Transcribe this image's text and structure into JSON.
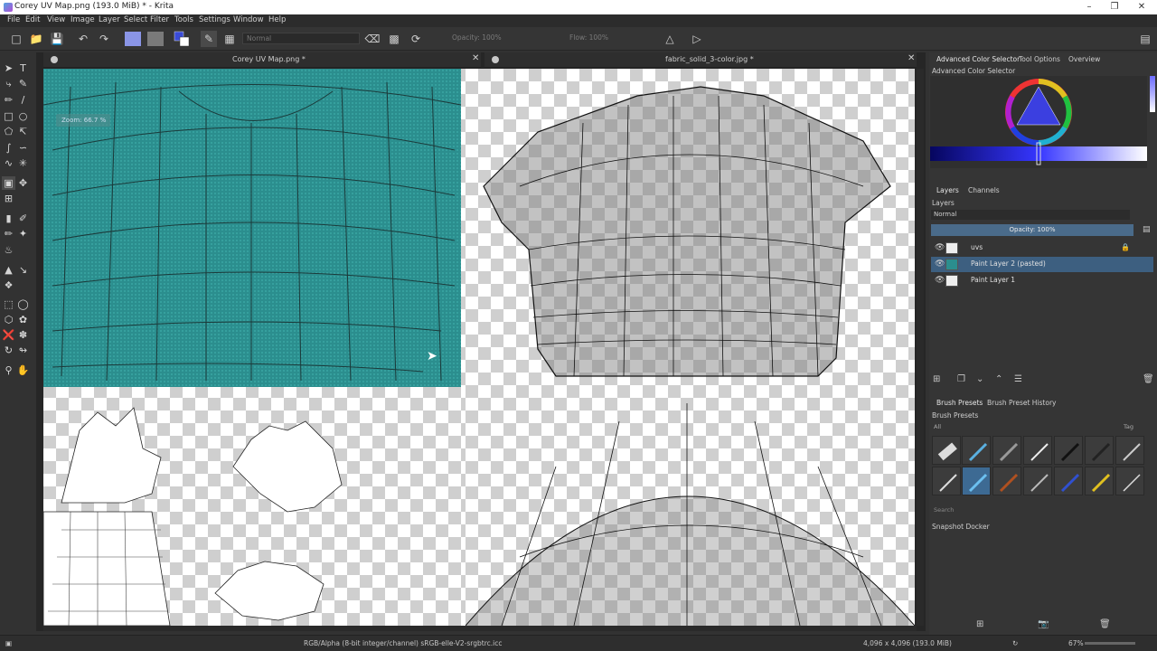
{
  "titlebar": {
    "title": "Corey UV Map.png (193.0 MiB)  * - Krita",
    "minimize": "–",
    "restore": "❐",
    "close": "✕"
  },
  "menu": [
    "File",
    "Edit",
    "View",
    "Image",
    "Layer",
    "Select",
    "Filter",
    "Tools",
    "Settings",
    "Window",
    "Help"
  ],
  "toolbar": {
    "blend_mode": "Normal",
    "opacity": "Opacity: 100%",
    "flow": "Flow: 100%"
  },
  "documents": [
    {
      "title": "Corey UV Map.png *",
      "close": "✕"
    },
    {
      "title": "fabric_solid_3-color.jpg *",
      "close": "✕"
    }
  ],
  "zoom_osd": "Zoom: 66.7 %",
  "dockers": {
    "color_tabs": [
      "Advanced Color Selector",
      "Tool Options",
      "Overview"
    ],
    "color_title": "Advanced Color Selector",
    "layers_tabs": [
      "Layers",
      "Channels"
    ],
    "layers_title": "Layers",
    "blend_mode": "Normal",
    "opacity": "Opacity: 100%",
    "layers": [
      {
        "name": "uvs"
      },
      {
        "name": "Paint Layer 2 (pasted)"
      },
      {
        "name": "Paint Layer 1"
      }
    ],
    "brush_tabs": [
      "Brush Presets",
      "Brush Preset History"
    ],
    "brush_title": "Brush Presets",
    "brush_filter": "All",
    "brush_tag": "Tag",
    "brush_search_placeholder": "Search",
    "snapshot_title": "Snapshot Docker"
  },
  "statusbar": {
    "color_space": "RGB/Alpha (8-bit integer/channel)  sRGB-elle-V2-srgbtrc.icc",
    "size": "4,096 x 4,096 (193.0 MiB)",
    "zoom": "67%"
  },
  "colors": {
    "accent": "#3d6a93",
    "selected_layer": "#3d5f80",
    "teal_fabric": "#2b8e8e"
  }
}
